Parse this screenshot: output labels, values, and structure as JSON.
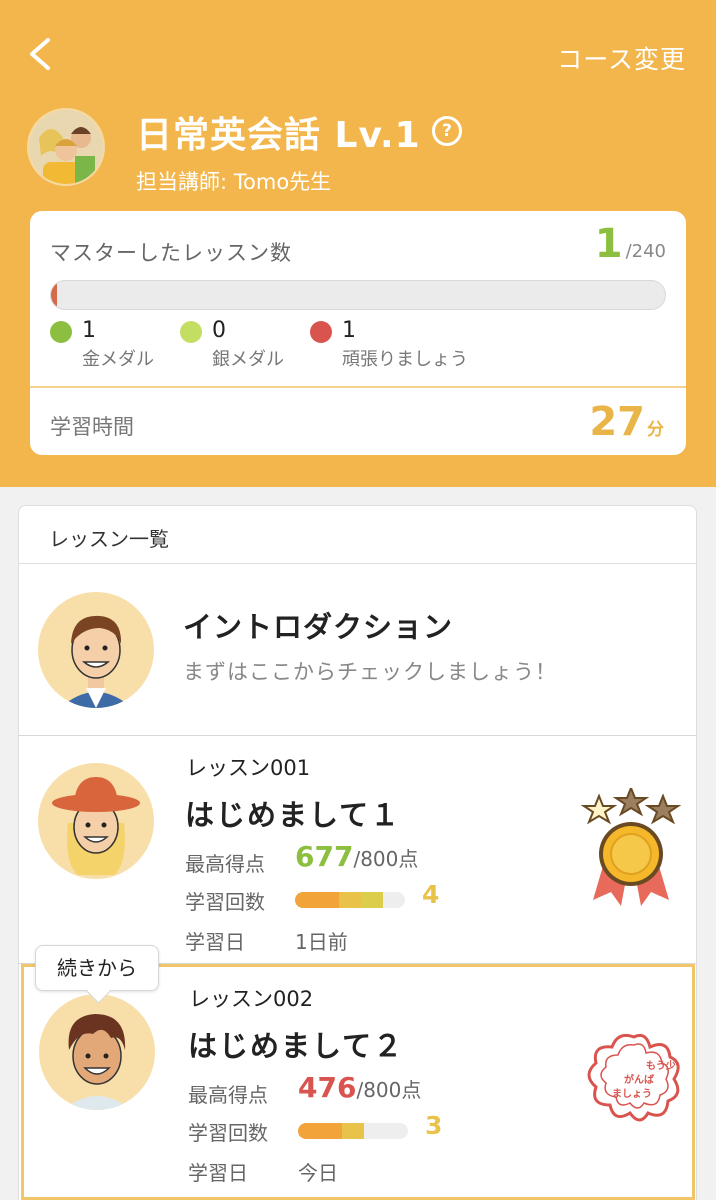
{
  "header": {
    "back_icon": "chevron-left-icon",
    "change_course": "コース変更",
    "course_title": "日常英会話 Lv.1",
    "help_icon": "help-circle-icon",
    "help_glyph": "?",
    "instructor": "担当講師: Tomo先生"
  },
  "stats": {
    "mastered_label": "マスターしたレッスン数",
    "mastered_count": "1",
    "mastered_total": "/240",
    "progress_fraction": 0.004,
    "legend": [
      {
        "count": "1",
        "label": "金メダル",
        "color": "#8cbf3f"
      },
      {
        "count": "0",
        "label": "銀メダル",
        "color": "#c4dd63"
      },
      {
        "count": "1",
        "label": "頑張りましょう",
        "color": "#d9534f"
      }
    ],
    "time_label": "学習時間",
    "time_value": "27",
    "time_unit": "分"
  },
  "lessons": {
    "heading": "レッスン一覧",
    "intro": {
      "title": "イントロダクション",
      "subtitle": "まずはここからチェックしましょう！"
    },
    "continue_label": "続きから",
    "score_label": "最高得点",
    "attempts_label": "学習回数",
    "date_label": "学習日",
    "items": [
      {
        "number": "レッスン001",
        "title": "はじめまして１",
        "score": "677",
        "score_max": "/800点",
        "score_color": "#8cbf3f",
        "attempts": "4",
        "attempt_segments": 4,
        "date": "1日前",
        "badge": "gold-medal-icon"
      },
      {
        "number": "レッスン002",
        "title": "はじめまして２",
        "score": "476",
        "score_max": "/800点",
        "score_color": "#d9534f",
        "attempts": "3",
        "attempt_segments": 3,
        "date": "今日",
        "badge": "try-again-stamp-icon"
      }
    ],
    "stamp_text": "もう少しがんばりましょう"
  }
}
